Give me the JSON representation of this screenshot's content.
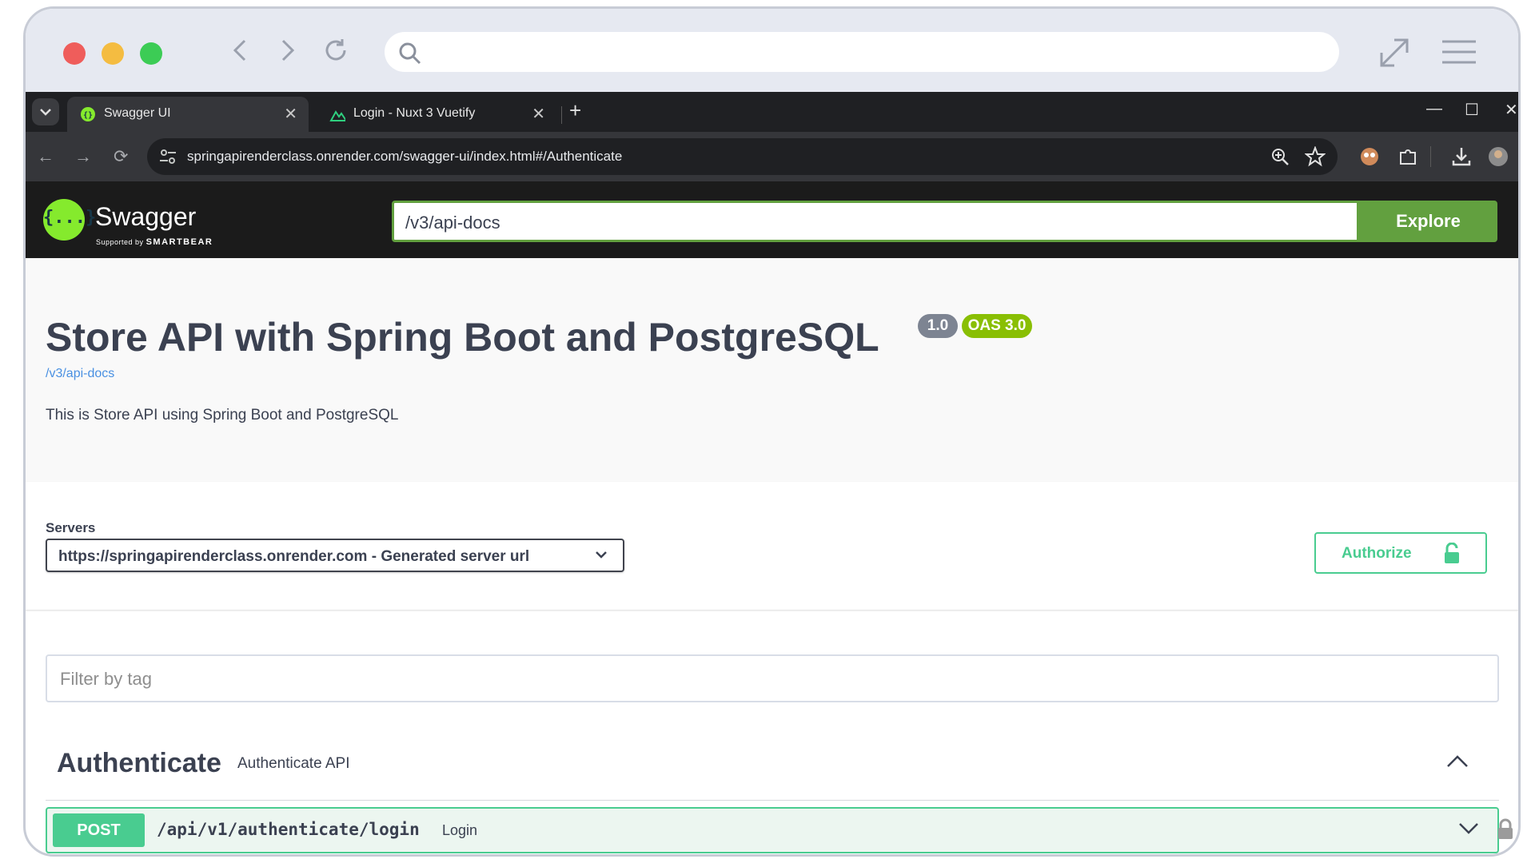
{
  "browser": {
    "tabs": [
      {
        "title": "Swagger UI",
        "active": true
      },
      {
        "title": "Login - Nuxt 3 Vuetify",
        "active": false
      }
    ],
    "address_bar": "springapirenderclass.onrender.com/swagger-ui/index.html#/Authenticate"
  },
  "swagger_header": {
    "logo_text": "Swagger",
    "logo_glyph": "{...}",
    "supported_by": "Supported by",
    "supported_brand": "SMARTBEAR",
    "spec_url": "/v3/api-docs",
    "explore_label": "Explore"
  },
  "info": {
    "title": "Store API with Spring Boot and PostgreSQL",
    "version": "1.0",
    "oas": "OAS 3.0",
    "link": "/v3/api-docs",
    "description": "This is Store API using Spring Boot and PostgreSQL"
  },
  "servers": {
    "label": "Servers",
    "selected": "https://springapirenderclass.onrender.com - Generated server url",
    "authorize_label": "Authorize"
  },
  "filter": {
    "placeholder": "Filter by tag"
  },
  "tags": [
    {
      "name": "Authenticate",
      "description": "Authenticate API",
      "operations": [
        {
          "method": "POST",
          "path": "/api/v1/authenticate/login",
          "summary": "Login"
        }
      ]
    }
  ],
  "colors": {
    "swagger_green": "#85ea2d",
    "explore_green": "#62a03f",
    "post_green": "#49cc90",
    "post_bg": "#ecf6f0",
    "badge_gray": "#7d8492",
    "badge_oas": "#89bf04",
    "link_blue": "#4990e2"
  }
}
